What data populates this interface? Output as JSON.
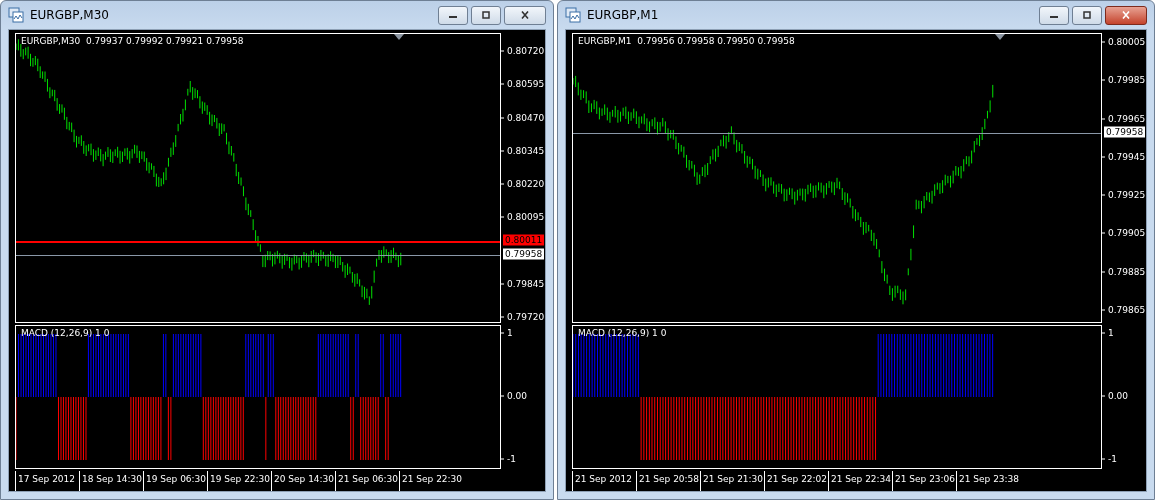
{
  "windows": [
    {
      "title": "EURGBP,M30",
      "active": false,
      "chart": {
        "header": "EURGBP,M30  0.79937 0.79992 0.79921 0.79958",
        "price_ticks": [
          "0.80720",
          "0.80595",
          "0.80470",
          "0.80345",
          "0.80220",
          "0.80095",
          "0.79845",
          "0.79720"
        ],
        "price_lines": [
          {
            "text": "0.80011",
            "kind": "alert"
          },
          {
            "text": "0.79958",
            "kind": "bid"
          }
        ],
        "indicator": {
          "label": "MACD (12,26,9) 1 0",
          "ticks": [
            "1",
            "0.00",
            "-1"
          ]
        },
        "time_labels": [
          "17 Sep 2012",
          "18 Sep 14:30",
          "19 Sep 06:30",
          "19 Sep 22:30",
          "20 Sep 14:30",
          "21 Sep 06:30",
          "21 Sep 22:30"
        ]
      }
    },
    {
      "title": "EURGBP,M1",
      "active": true,
      "chart": {
        "header": "EURGBP,M1  0.79956 0.79958 0.79950 0.79958",
        "price_ticks": [
          "0.80005",
          "0.79985",
          "0.79965",
          "0.79945",
          "0.79925",
          "0.79905",
          "0.79885",
          "0.79865"
        ],
        "price_lines": [
          {
            "text": "0.79958",
            "kind": "bid"
          }
        ],
        "indicator": {
          "label": "MACD (12,26,9) 1 0",
          "ticks": [
            "1",
            "0.00",
            "-1"
          ]
        },
        "time_labels": [
          "21 Sep 2012",
          "21 Sep 20:58",
          "21 Sep 21:30",
          "21 Sep 22:02",
          "21 Sep 22:34",
          "21 Sep 23:06",
          "21 Sep 23:38"
        ]
      }
    }
  ]
}
